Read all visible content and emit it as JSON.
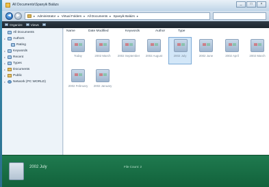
{
  "window": {
    "title": "All Documents\\Spanyik Balázs",
    "buttons": [
      "_",
      "□",
      "×"
    ]
  },
  "address": {
    "path": [
      "Administrator",
      "Virtual Folders",
      "All Documents",
      "Spanyik Balázs"
    ],
    "search_placeholder": ""
  },
  "toolbar": {
    "items": [
      "Organize",
      "Views",
      ""
    ]
  },
  "navpane": {
    "items": [
      {
        "label": "All Documents",
        "icon": "search-icon"
      },
      {
        "label": "Authors",
        "icon": "search-icon"
      },
      {
        "label": "Rating",
        "icon": "search-icon"
      },
      {
        "label": "Keywords",
        "icon": "search-icon"
      },
      {
        "label": "Recent",
        "icon": "search-icon"
      },
      {
        "label": "Types",
        "icon": "search-icon"
      },
      {
        "label": "Documents",
        "icon": "folder-icon"
      },
      {
        "label": "Public",
        "icon": "folder-icon"
      },
      {
        "label": "Network (PC WORLD)",
        "icon": "network-icon"
      }
    ]
  },
  "columns": [
    "Name",
    "Date Modified",
    "Keywords",
    "Author",
    "Type"
  ],
  "tiles": [
    {
      "label": "Today"
    },
    {
      "label": "2002 March"
    },
    {
      "label": "2002 September"
    },
    {
      "label": "2002 August"
    },
    {
      "label": "2002 July",
      "selected": true
    },
    {
      "label": "2002 June"
    },
    {
      "label": "2002 April"
    },
    {
      "label": "2002 March"
    },
    {
      "label": "2002 February"
    },
    {
      "label": "2002 January"
    }
  ],
  "details": {
    "name": "2002 July",
    "info": "File Count: 2"
  },
  "colors": {
    "details_bg": "#1f7a4f",
    "toolbar_bg": "#2f3a45",
    "accent": "#1c5fae"
  }
}
